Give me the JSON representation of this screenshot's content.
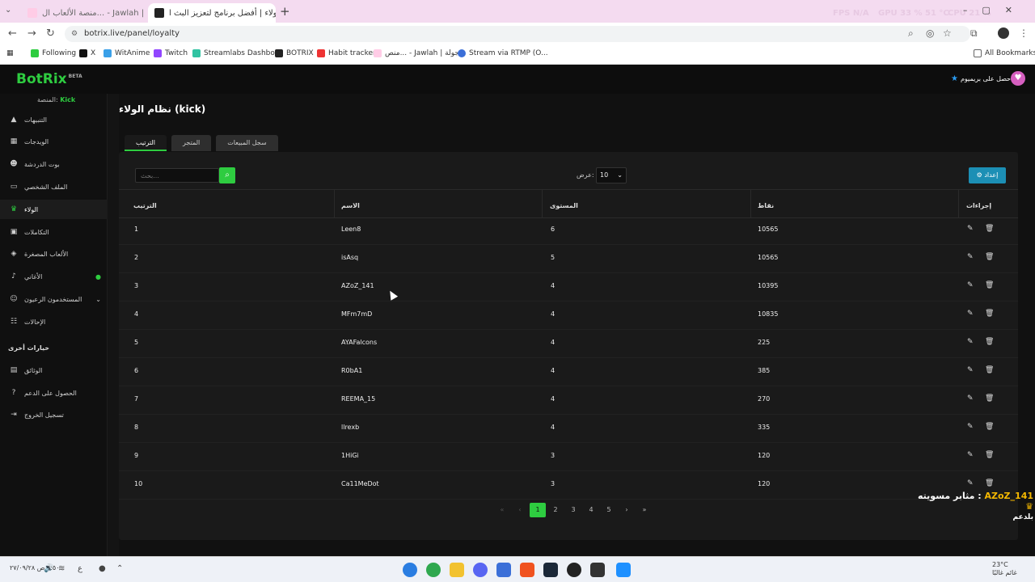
{
  "browser": {
    "tabs": [
      {
        "title": "منصة الألعاب ال... - Jawlah | جولة",
        "active": false
      },
      {
        "title": "الولاء | أفضل برنامج لتعزيز البث ا...",
        "active": true
      }
    ],
    "new_tab": "+",
    "overlay_stats": {
      "fps": "FPS N/A",
      "gpu": "GPU 33 % 51 °C",
      "cpu": "CPU 21 %"
    },
    "url": "botrix.live/panel/loyalty",
    "bookmarks": [
      "Following",
      "X",
      "WitAnime",
      "Twitch",
      "Streamlabs Dashbo...",
      "BOTRIX",
      "Habit tracker",
      "منص... - Jawlah | جولة",
      "Stream via RTMP (O..."
    ],
    "all_bookmarks": "All Bookmarks"
  },
  "app": {
    "logo": "BotRix",
    "logo_badge": "BETA",
    "premium_label": "احصل على بريميوم",
    "platform_label": "المنصة:",
    "platform_value": "Kick"
  },
  "sidebar": {
    "items": [
      {
        "label": "التنبيهات",
        "icon": "warning-icon"
      },
      {
        "label": "الويدجات",
        "icon": "grid-icon"
      },
      {
        "label": "بوت الدردشة",
        "icon": "robot-icon"
      },
      {
        "label": "الملف الشخصي",
        "icon": "id-card-icon"
      },
      {
        "label": "الولاء",
        "icon": "trophy-icon"
      },
      {
        "label": "التكاملات",
        "icon": "puzzle-icon"
      },
      {
        "label": "الألعاب المصغرة",
        "icon": "gamepad-icon"
      },
      {
        "label": "الأغاني",
        "icon": "music-icon"
      },
      {
        "label": "المستخدمون الرعيون",
        "icon": "users-icon"
      },
      {
        "label": "الإحالات",
        "icon": "referral-icon"
      }
    ],
    "section_title": "خيارات أخرى",
    "other_items": [
      {
        "label": "الوثائق",
        "icon": "docs-icon"
      },
      {
        "label": "الحصول على الدعم",
        "icon": "help-icon"
      },
      {
        "label": "تسجيل الخروج",
        "icon": "logout-icon"
      }
    ]
  },
  "main": {
    "title": "نظام الولاء (kick)",
    "tabs": [
      "الترتيب",
      "المتجر",
      "سجل المبيعات"
    ],
    "search_placeholder": "بحث...",
    "show_label": "عرض:",
    "show_value": "10",
    "setup_button": "إعداد",
    "columns": [
      "الترتيب",
      "الاسم",
      "المستوى",
      "نقاط",
      "إجراءات"
    ],
    "rows": [
      {
        "rank": "1",
        "name": "Leen8",
        "level": "6",
        "points": "10565"
      },
      {
        "rank": "2",
        "name": "isAsq",
        "level": "5",
        "points": "10565"
      },
      {
        "rank": "3",
        "name": "AZoZ_141",
        "level": "4",
        "points": "10395"
      },
      {
        "rank": "4",
        "name": "MFm7mD",
        "level": "4",
        "points": "10835"
      },
      {
        "rank": "5",
        "name": "AYAFalcons",
        "level": "4",
        "points": "225"
      },
      {
        "rank": "6",
        "name": "R0bA1",
        "level": "4",
        "points": "385"
      },
      {
        "rank": "7",
        "name": "REEMA_15",
        "level": "4",
        "points": "270"
      },
      {
        "rank": "8",
        "name": "llrexb",
        "level": "4",
        "points": "335"
      },
      {
        "rank": "9",
        "name": "1HiGi",
        "level": "3",
        "points": "120"
      },
      {
        "rank": "10",
        "name": "Ca11MeDot",
        "level": "3",
        "points": "120"
      }
    ],
    "pagination": [
      "«",
      "‹",
      "1",
      "2",
      "3",
      "4",
      "5",
      "›",
      "»"
    ],
    "current_page": "1"
  },
  "stream_overlay": {
    "text": "مثابر مسويته :",
    "name": "AZoZ_141",
    "line2": "بلدعم"
  },
  "taskbar": {
    "clock": "٦:٥٠ ص ٢٧/٠٩/٢٨",
    "weather_temp": "23°C",
    "weather_desc": "غائم غالبًا"
  },
  "colors": {
    "accent": "#2ecc40",
    "setup_button": "#1c8fb5",
    "background": "#141414"
  }
}
